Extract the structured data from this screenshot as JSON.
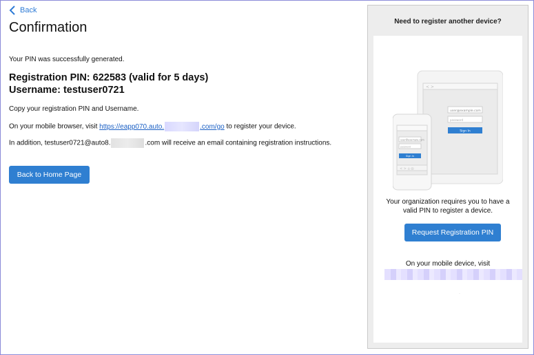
{
  "nav": {
    "back_label": "Back"
  },
  "page": {
    "title": "Confirmation",
    "success_message": "Your PIN was successfully generated.",
    "registration_pin_line": "Registration PIN: 622583 (valid for 5 days)",
    "username_line": "Username: testuser0721",
    "copy_instruction": "Copy your registration PIN and Username.",
    "mobile_prefix": "On your mobile browser, visit ",
    "mobile_link_start": "https://eapp070.auto.",
    "mobile_link_end": ".com/go",
    "mobile_suffix": " to register your device.",
    "email_prefix": "In addition, testuser0721@auto8.",
    "email_suffix": ".com will receive an email containing registration instructions.",
    "home_button_label": "Back to Home Page"
  },
  "panel": {
    "title": "Need to register another device?",
    "org_text": "Your organization requires you to have a valid PIN to register a device.",
    "request_button_label": "Request Registration PIN",
    "visit_text": "On your mobile device, visit",
    "mock": {
      "tablet_email": "user@example.com",
      "tablet_password": "password",
      "tablet_signin": "Sign In",
      "phone_email": "user@example.com",
      "phone_password": "password",
      "phone_signin": "Sign In"
    }
  },
  "colors": {
    "accent": "#2f7fd1",
    "link": "#1a5fc4",
    "frame_border": "#8a8ad8",
    "panel_bg": "#ededed"
  }
}
